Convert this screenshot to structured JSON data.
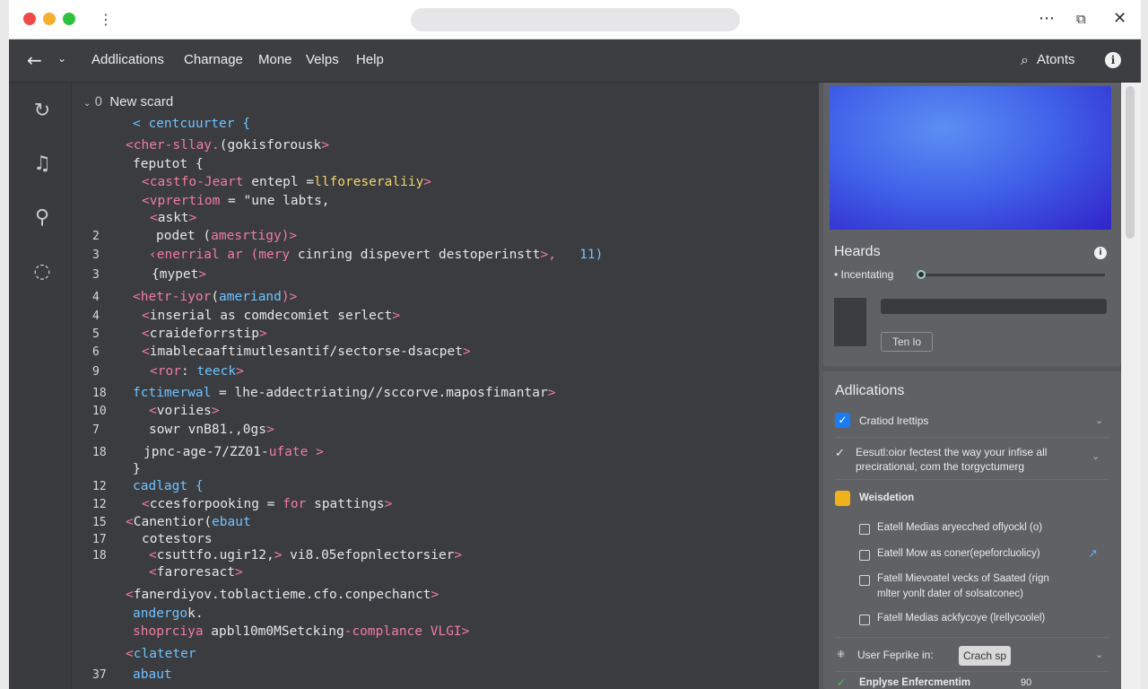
{
  "titlebar": {
    "more_glyph": "⋮",
    "right_icons": [
      "⋯",
      "⧉",
      "✕"
    ]
  },
  "menubar": {
    "items": [
      "Addlications",
      "Charnage",
      "Mone",
      "Velps",
      "Help"
    ],
    "actions_label": "Atonts",
    "info_glyph": "i"
  },
  "rail": {
    "icons": [
      "refresh-icon",
      "music-note-icon",
      "search-person-icon",
      "loading-icon"
    ]
  },
  "editor": {
    "tree_title": "New scard",
    "tree_zero": "0",
    "lines": [
      {
        "ln": "",
        "segs": [
          {
            "t": "< ",
            "c": "#6fc2ff"
          },
          {
            "t": "centcuurter {",
            "c": "#6fc2ff"
          }
        ]
      },
      {
        "ln": "",
        "segs": [
          {
            "t": "<",
            "c": "#f07ca0"
          },
          {
            "t": "cher-sllay.",
            "c": "#f07ca0"
          },
          {
            "t": "(gokisforousk",
            "c": "#e6e6e6"
          },
          {
            "t": ">",
            "c": "#f07ca0"
          }
        ]
      },
      {
        "ln": "",
        "segs": [
          {
            "t": "feputot {",
            "c": "#e6e6e6"
          }
        ]
      },
      {
        "ln": "",
        "segs": [
          {
            "t": "<",
            "c": "#f07ca0"
          },
          {
            "t": "castfo-Jeart",
            "c": "#f07ca0"
          },
          {
            "t": " entepl =",
            "c": "#e6e6e6"
          },
          {
            "t": "llforeseraliiy",
            "c": "#f3d36b"
          },
          {
            "t": ">",
            "c": "#f07ca0"
          }
        ]
      },
      {
        "ln": "",
        "segs": [
          {
            "t": "<",
            "c": "#f07ca0"
          },
          {
            "t": "vprertiom",
            "c": "#f07ca0"
          },
          {
            "t": " = \"une labts,",
            "c": "#e6e6e6"
          }
        ]
      },
      {
        "ln": "",
        "segs": [
          {
            "t": "<",
            "c": "#f07ca0"
          },
          {
            "t": "askt",
            "c": "#e6e6e6"
          },
          {
            "t": ">",
            "c": "#f07ca0"
          }
        ]
      },
      {
        "ln": "2",
        "segs": [
          {
            "t": "podet (",
            "c": "#e6e6e6"
          },
          {
            "t": "amesrtigy",
            "c": "#f07ca0"
          },
          {
            "t": ")>",
            "c": "#f07ca0"
          }
        ]
      },
      {
        "ln": "3",
        "segs": [
          {
            "t": "‹enerrial ar (",
            "c": "#f07ca0"
          },
          {
            "t": "mery",
            "c": "#f07ca0"
          },
          {
            "t": " cinring dispevert destoperinstt",
            "c": "#e6e6e6"
          },
          {
            "t": ">,",
            "c": "#f07ca0"
          },
          {
            "t": "   11)",
            "c": "#6fc2ff"
          }
        ]
      },
      {
        "ln": "3",
        "segs": [
          {
            "t": "{mypet",
            "c": "#e6e6e6"
          },
          {
            "t": ">",
            "c": "#f07ca0"
          }
        ]
      },
      {
        "ln": "4",
        "segs": [
          {
            "t": "<",
            "c": "#f07ca0"
          },
          {
            "t": "hetr-iyor",
            "c": "#f07ca0"
          },
          {
            "t": "(",
            "c": "#e6e6e6"
          },
          {
            "t": "ameriand",
            "c": "#6fc2ff"
          },
          {
            "t": ")>",
            "c": "#f07ca0"
          }
        ]
      },
      {
        "ln": "4",
        "segs": [
          {
            "t": "<",
            "c": "#f07ca0"
          },
          {
            "t": "inserial as comdecomiet serlect",
            "c": "#e6e6e6"
          },
          {
            "t": ">",
            "c": "#f07ca0"
          }
        ]
      },
      {
        "ln": "5",
        "segs": [
          {
            "t": "<",
            "c": "#f07ca0"
          },
          {
            "t": "craideforrstip",
            "c": "#e6e6e6"
          },
          {
            "t": ">",
            "c": "#f07ca0"
          }
        ]
      },
      {
        "ln": "6",
        "segs": [
          {
            "t": "<",
            "c": "#f07ca0"
          },
          {
            "t": "imablecaaftimutlesantif/sectorse-dsacpet",
            "c": "#e6e6e6"
          },
          {
            "t": ">",
            "c": "#f07ca0"
          }
        ]
      },
      {
        "ln": "9",
        "segs": [
          {
            "t": "<",
            "c": "#f07ca0"
          },
          {
            "t": "ror",
            "c": "#f07ca0"
          },
          {
            "t": ": ",
            "c": "#e6e6e6"
          },
          {
            "t": "teeck",
            "c": "#6fc2ff"
          },
          {
            "t": ">",
            "c": "#f07ca0"
          }
        ]
      },
      {
        "ln": "18",
        "segs": [
          {
            "t": "fctimerwal",
            "c": "#6fc2ff"
          },
          {
            "t": " = lhe-addectriating//sccorve.maposfimantar",
            "c": "#e6e6e6"
          },
          {
            "t": ">",
            "c": "#f07ca0"
          }
        ]
      },
      {
        "ln": "10",
        "segs": [
          {
            "t": "<",
            "c": "#f07ca0"
          },
          {
            "t": "voriies",
            "c": "#e6e6e6"
          },
          {
            "t": ">",
            "c": "#f07ca0"
          }
        ]
      },
      {
        "ln": "7",
        "segs": [
          {
            "t": "sowr vnB81.,0gs",
            "c": "#e6e6e6"
          },
          {
            "t": ">",
            "c": "#f07ca0"
          }
        ]
      },
      {
        "ln": "18",
        "segs": [
          {
            "t": "jpnc-age-7/ZZ01-",
            "c": "#e6e6e6"
          },
          {
            "t": "ufate",
            "c": "#f07ca0"
          },
          {
            "t": " >",
            "c": "#f07ca0"
          }
        ]
      },
      {
        "ln": "",
        "segs": [
          {
            "t": "}",
            "c": "#e6e6e6"
          }
        ]
      },
      {
        "ln": "12",
        "segs": [
          {
            "t": "cadlagt {",
            "c": "#6fc2ff"
          }
        ]
      },
      {
        "ln": "12",
        "segs": [
          {
            "t": "<",
            "c": "#f07ca0"
          },
          {
            "t": "ccesforpooking",
            "c": "#e6e6e6"
          },
          {
            "t": " = ",
            "c": "#e6e6e6"
          },
          {
            "t": "for",
            "c": "#f07ca0"
          },
          {
            "t": " spattings",
            "c": "#e6e6e6"
          },
          {
            "t": ">",
            "c": "#f07ca0"
          }
        ]
      },
      {
        "ln": "15",
        "segs": [
          {
            "t": "<",
            "c": "#f07ca0"
          },
          {
            "t": "Canentior",
            "c": "#e6e6e6"
          },
          {
            "t": "(",
            "c": "#e6e6e6"
          },
          {
            "t": "ebaut",
            "c": "#6fc2ff"
          }
        ]
      },
      {
        "ln": "17",
        "segs": [
          {
            "t": "cotestors",
            "c": "#e6e6e6"
          }
        ]
      },
      {
        "ln": "18",
        "segs": [
          {
            "t": "<",
            "c": "#f07ca0"
          },
          {
            "t": "csuttfo.ugir12,",
            "c": "#e6e6e6"
          },
          {
            "t": ">",
            "c": "#f07ca0"
          },
          {
            "t": " vi8.05efopnlectorsier",
            "c": "#e6e6e6"
          },
          {
            "t": ">",
            "c": "#f07ca0"
          }
        ]
      },
      {
        "ln": "",
        "segs": [
          {
            "t": "<",
            "c": "#f07ca0"
          },
          {
            "t": "faroresact",
            "c": "#e6e6e6"
          },
          {
            "t": ">",
            "c": "#f07ca0"
          }
        ]
      },
      {
        "ln": "",
        "segs": [
          {
            "t": "<",
            "c": "#f07ca0"
          },
          {
            "t": "fanerdiyov.toblactieme.cfo.conpechanct",
            "c": "#e6e6e6"
          },
          {
            "t": ">",
            "c": "#f07ca0"
          }
        ]
      },
      {
        "ln": "",
        "segs": [
          {
            "t": "andergo",
            "c": "#6fc2ff"
          },
          {
            "t": "k.",
            "c": "#e6e6e6"
          }
        ]
      },
      {
        "ln": "",
        "segs": [
          {
            "t": "shoprciya",
            "c": "#f07ca0"
          },
          {
            "t": " apbl10m0MSetcking",
            "c": "#e6e6e6"
          },
          {
            "t": "-complance VLGI",
            "c": "#f07ca0"
          },
          {
            "t": ">",
            "c": "#f07ca0"
          }
        ]
      },
      {
        "ln": "",
        "segs": [
          {
            "t": "<",
            "c": "#f07ca0"
          },
          {
            "t": "clateter",
            "c": "#6fc2ff"
          }
        ]
      },
      {
        "ln": "37",
        "segs": [
          {
            "t": "abaut",
            "c": "#6fc2ff"
          }
        ]
      }
    ]
  },
  "panel": {
    "card_title": "Heards",
    "slider_label": "• Incentating",
    "slider_value": 0.02,
    "ten_button": "Ten lo",
    "apps_title": "Adlications",
    "row1": "Cratiod lrettips",
    "row2_line1": "Eesutl:oior fectest the way your infise all",
    "row2_line2": "precirational, com the torgyctumerg",
    "row3": "Weisdetion",
    "sub1": "Eatell Medias aryecched oflyockl (o)",
    "sub2": "Eatell Mow as coner(epeforcluolicy)",
    "sub3_line1": "Fatell Mievoatel vecks of Saated (rign",
    "sub3_line2": "mlter yonlt dater of solsatconec)",
    "sub4": "Fatell Medias ackfycoye (lrellycoolel)",
    "user_label": "User Feprike in:",
    "user_button": "Crach sp",
    "bottom_row": "Enplyse Enfercmentim",
    "bottom_value": "90"
  }
}
